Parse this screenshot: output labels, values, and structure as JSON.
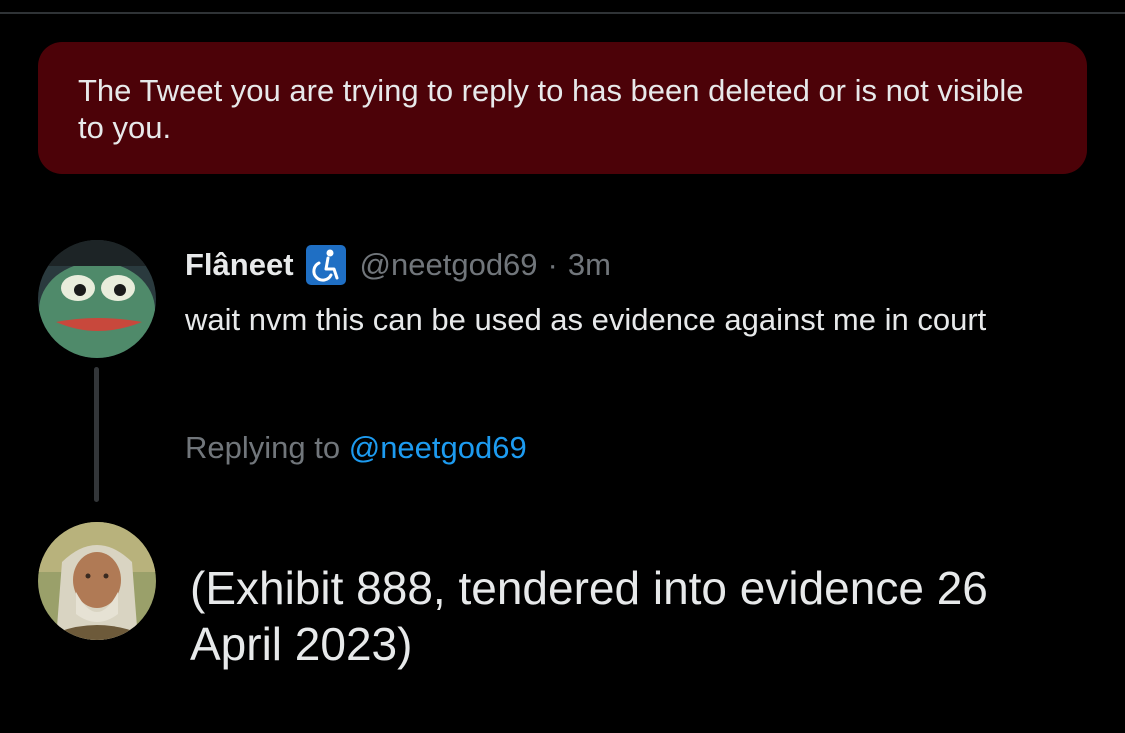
{
  "error_banner": {
    "text": "The Tweet you are trying to reply to has been deleted or is not visible to you."
  },
  "tweet": {
    "display_name": "Flâneet",
    "badge_icon": "wheelchair-icon",
    "handle": "@neetgod69",
    "separator": "·",
    "timestamp": "3m",
    "text": "wait nvm this can be used as evidence against me in court",
    "replying_label": "Replying to",
    "replying_handle": "@neetgod69"
  },
  "reply": {
    "text": "(Exhibit 888, tendered into evidence 26 April 2023)"
  },
  "colors": {
    "background": "#000000",
    "banner": "#4c0208",
    "link": "#1d9bf0",
    "muted": "#71767b",
    "text": "#e7e9ea",
    "badge": "#1f6fc4"
  }
}
